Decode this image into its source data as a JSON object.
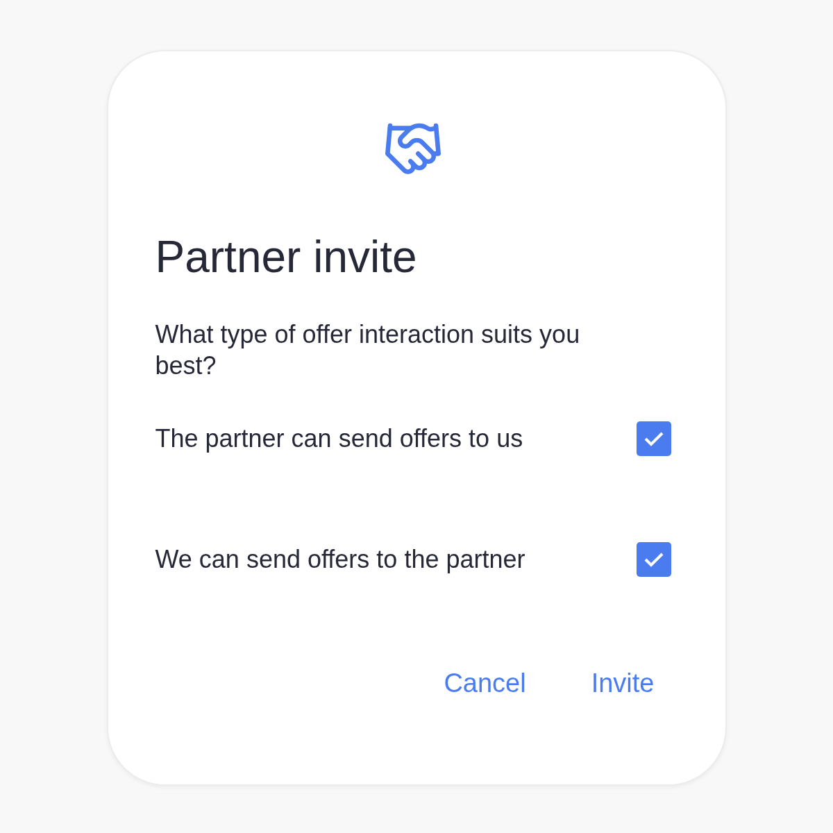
{
  "dialog": {
    "title": "Partner invite",
    "question": "What type of offer interaction suits you best?",
    "options": [
      {
        "label": "The partner can send offers to us",
        "checked": true
      },
      {
        "label": "We can send offers to the partner",
        "checked": true
      }
    ],
    "buttons": [
      "Cancel",
      "Invite"
    ]
  }
}
